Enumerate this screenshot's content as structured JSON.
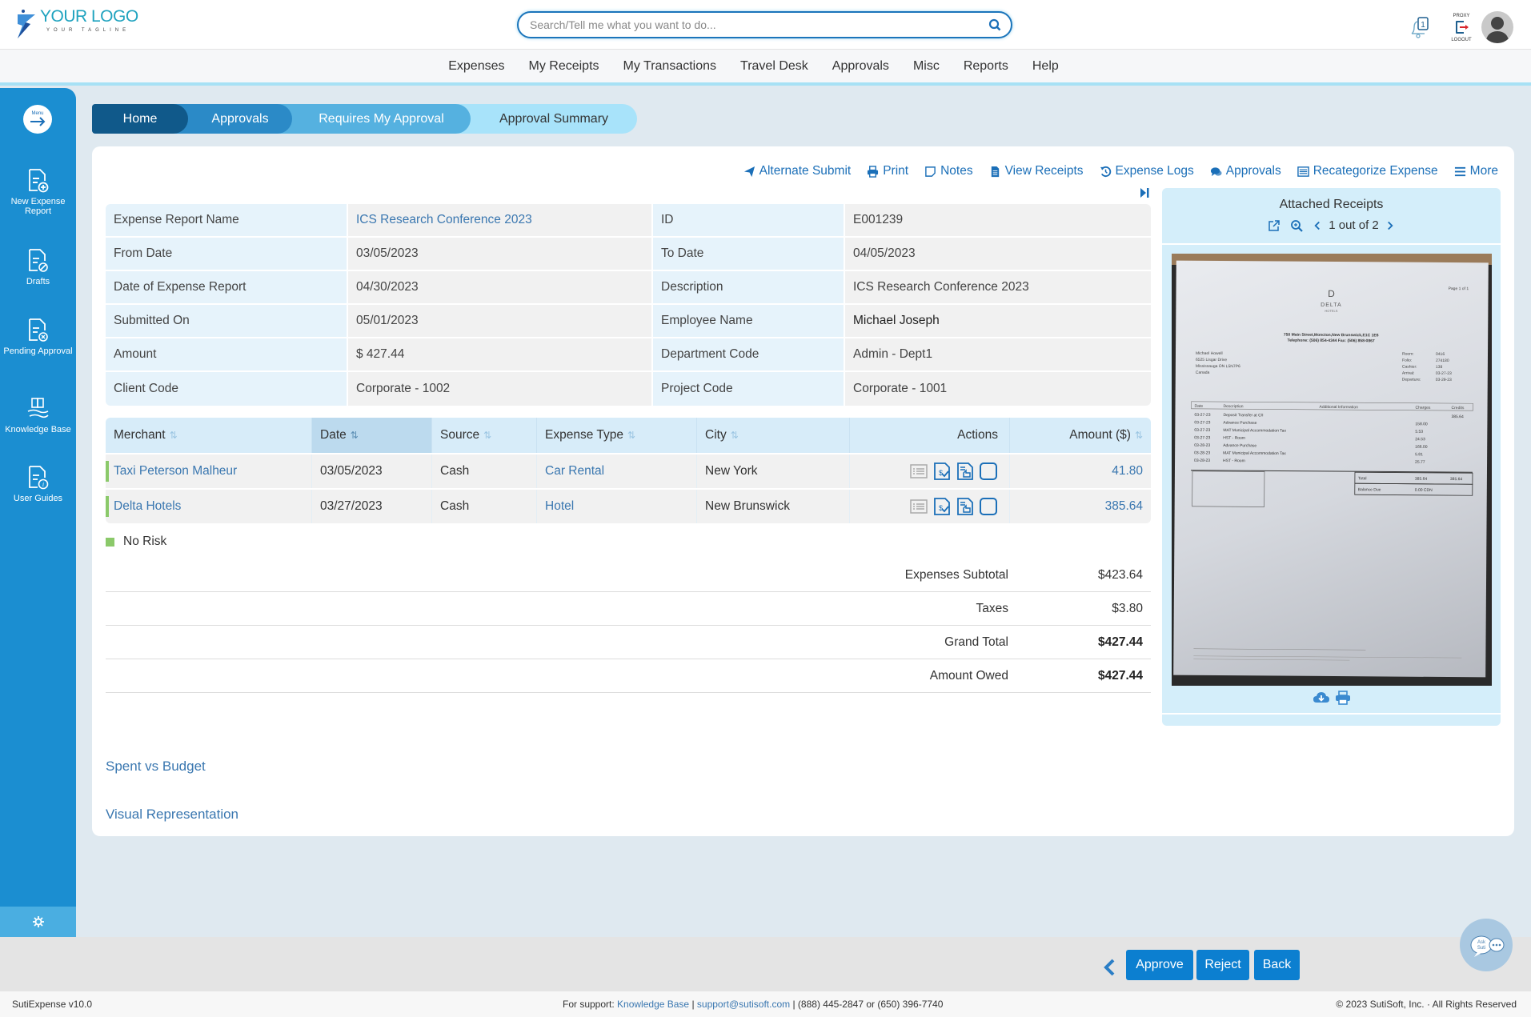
{
  "header": {
    "logo_title": "YOUR LOGO",
    "logo_tagline": "YOUR TAGLINE",
    "search_placeholder": "Search/Tell me what you want to do...",
    "notification_count": "1",
    "proxy_logout_top": "PROXY",
    "proxy_logout_bottom": "LOGOUT"
  },
  "nav": {
    "items": [
      "Expenses",
      "My Receipts",
      "My Transactions",
      "Travel Desk",
      "Approvals",
      "Misc",
      "Reports",
      "Help"
    ]
  },
  "sidebar": {
    "menu_label": "Menu",
    "items": [
      {
        "label": "New Expense Report",
        "icon": "new-report-icon"
      },
      {
        "label": "Drafts",
        "icon": "drafts-icon"
      },
      {
        "label": "Pending Approval",
        "icon": "pending-approval-icon"
      },
      {
        "label": "Knowledge Base",
        "icon": "knowledge-base-icon"
      },
      {
        "label": "User Guides",
        "icon": "user-guides-icon"
      }
    ]
  },
  "breadcrumb": [
    "Home",
    "Approvals",
    "Requires My Approval",
    "Approval Summary"
  ],
  "toolbar": {
    "items": [
      {
        "label": "Alternate Submit",
        "icon": "paper-plane-icon"
      },
      {
        "label": "Print",
        "icon": "print-icon"
      },
      {
        "label": "Notes",
        "icon": "notes-icon"
      },
      {
        "label": "View Receipts",
        "icon": "document-icon"
      },
      {
        "label": "Expense Logs",
        "icon": "history-icon"
      },
      {
        "label": "Approvals",
        "icon": "comments-icon"
      },
      {
        "label": "Recategorize Expense",
        "icon": "list-box-icon"
      },
      {
        "label": "More",
        "icon": "hamburger-icon"
      }
    ]
  },
  "report_info": {
    "rows": [
      {
        "l1": "Expense Report Name",
        "v1": "ICS Research Conference 2023",
        "l2": "ID",
        "v2": "E001239"
      },
      {
        "l1": "From Date",
        "v1": "03/05/2023",
        "l2": "To Date",
        "v2": "04/05/2023"
      },
      {
        "l1": "Date of Expense Report",
        "v1": "04/30/2023",
        "l2": "Description",
        "v2": "ICS Research Conference 2023"
      },
      {
        "l1": "Submitted On",
        "v1": "05/01/2023",
        "l2": "Employee Name",
        "v2": "Michael Joseph"
      },
      {
        "l1": "Amount",
        "v1": "$ 427.44",
        "l2": "Department Code",
        "v2": "Admin - Dept1"
      },
      {
        "l1": "Client Code",
        "v1": "Corporate - 1002",
        "l2": "Project Code",
        "v2": "Corporate - 1001"
      }
    ]
  },
  "expenses": {
    "columns": [
      "Merchant",
      "Date",
      "Source",
      "Expense Type",
      "City",
      "Actions",
      "Amount ($)"
    ],
    "sort_glyph": "⇅",
    "rows": [
      {
        "merchant": "Taxi Peterson Malheur",
        "date": "03/05/2023",
        "source": "Cash",
        "type": "Car Rental",
        "city": "New York",
        "amount": "41.80",
        "risk": "No Risk"
      },
      {
        "merchant": "Delta Hotels",
        "date": "03/27/2023",
        "source": "Cash",
        "type": "Hotel",
        "city": "New Brunswick",
        "amount": "385.64",
        "risk": "No Risk"
      }
    ],
    "legend": "No Risk",
    "risk_color": "#8bc96a"
  },
  "totals": [
    {
      "label": "Expenses Subtotal",
      "value": "$423.64",
      "bold": false
    },
    {
      "label": "Taxes",
      "value": "$3.80",
      "bold": false
    },
    {
      "label": "Grand Total",
      "value": "$427.44",
      "bold": true
    },
    {
      "label": "Amount Owed",
      "value": "$427.44",
      "bold": true
    }
  ],
  "sections": {
    "spent_vs_budget": "Spent vs Budget",
    "visual_representation": "Visual Representation"
  },
  "receipts": {
    "title": "Attached Receipts",
    "pager": "1 out of 2",
    "current": 1,
    "total": 2,
    "receipt_text": {
      "brand": "DELTA",
      "sub": "HOTELS",
      "address": "750 Main Street,Moncton,New Brunswick,E1C 1E6",
      "phone": "Telephone: (506) 854-4344 Fax: (506) 858-0867",
      "page": "Page 1 of 1",
      "guest": [
        "Michael Howell",
        "6525 Lisgar Drive",
        "Mississauga ON L5N7P6",
        "Canada"
      ],
      "meta": [
        [
          "Room:",
          "0416"
        ],
        [
          "Folio:",
          "274180"
        ],
        [
          "Cashier:",
          "138"
        ],
        [
          "Arrival:",
          "03-27-23"
        ],
        [
          "Departure:",
          "03-29-23"
        ]
      ],
      "lines": [
        [
          "03-27-23",
          "Deposit Transfer at C/I",
          "",
          "385.64"
        ],
        [
          "03-27-23",
          "Advance Purchase",
          "158.00",
          ""
        ],
        [
          "03-27-23",
          "MAT Municipal Accommodation Tax",
          "5.53",
          ""
        ],
        [
          "03-27-23",
          "HST - Room",
          "24.53",
          ""
        ],
        [
          "03-28-23",
          "Advance Purchase",
          "166.00",
          ""
        ],
        [
          "03-28-23",
          "MAT Municipal Accommodation Tax",
          "5.81",
          ""
        ],
        [
          "03-28-23",
          "HST - Room",
          "25.77",
          ""
        ]
      ],
      "total": [
        "Total",
        "385.64",
        "385.64"
      ],
      "balance": [
        "Balance Due",
        "0.00 CDN"
      ]
    }
  },
  "actions": {
    "approve": "Approve",
    "reject": "Reject",
    "back": "Back"
  },
  "ask_suti": "Ask Suti",
  "footer": {
    "version": "SutiExpense v10.0",
    "support_prefix": "For support: ",
    "kb_link": "Knowledge Base",
    "email": "support@sutisoft.com",
    "phones": " | (888) 445-2847 or (650) 396-7740",
    "copyright": "© 2023 SutiSoft, Inc. · All Rights Reserved"
  },
  "colors": {
    "primary": "#1b8ed1",
    "button": "#0c7fd0",
    "link": "#3a77b0",
    "crumb_home": "#10598a"
  }
}
